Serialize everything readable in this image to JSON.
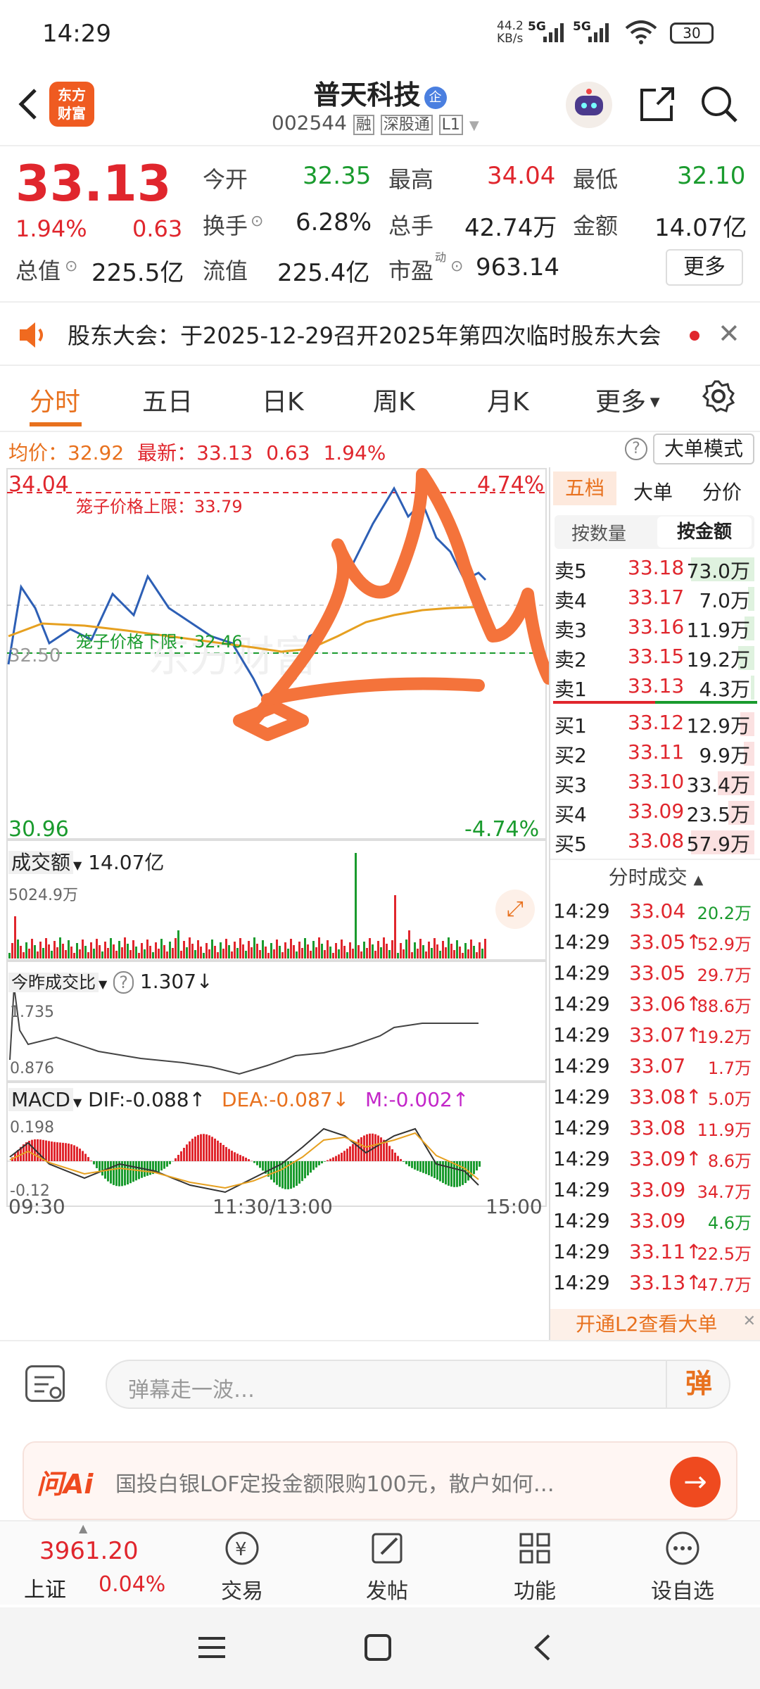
{
  "status_bar": {
    "time": "14:29",
    "net_speed": "44.2",
    "net_unit": "KB/s",
    "signal1": "5G",
    "signal2": "5G",
    "battery": "30"
  },
  "header": {
    "logo_line1": "东方",
    "logo_line2": "财富",
    "stock_name": "普天科技",
    "company_badge": "企",
    "stock_code": "002544",
    "tags": [
      "融",
      "深股通",
      "L1"
    ]
  },
  "quote": {
    "price": "33.13",
    "pct": "1.94%",
    "change": "0.63",
    "open_label": "今开",
    "open": "32.35",
    "high_label": "最高",
    "high": "34.04",
    "low_label": "最低",
    "low": "32.10",
    "turnover_label": "换手",
    "turnover": "6.28%",
    "volume_label": "总手",
    "volume": "42.74万",
    "amount_label": "金额",
    "amount": "14.07亿",
    "mktcap_label": "总值",
    "mktcap": "225.5亿",
    "float_label": "流值",
    "float": "225.4亿",
    "pe_label": "市盈",
    "pe_sup": "动",
    "pe": "963.14",
    "more": "更多"
  },
  "notice": {
    "text": "股东大会：于2025-12-29召开2025年第四次临时股东大会"
  },
  "tabs": [
    "分时",
    "五日",
    "日K",
    "周K",
    "月K",
    "更多"
  ],
  "chart_info": {
    "avg_label": "均价：",
    "avg": "32.92",
    "last_label": "最新：",
    "last": "33.13",
    "chg": "0.63",
    "pct": "1.94%",
    "mode_button": "大单模式"
  },
  "chart_labels": {
    "ymax": "34.04",
    "ymax_pct": "4.74%",
    "ymin": "30.96",
    "ymin_pct": "-4.74%",
    "mid": "32.50",
    "upper_limit": "笼子价格上限：33.79",
    "lower_limit": "笼子价格下限：32.46",
    "watermark": "东方财富"
  },
  "volume_panel": {
    "label": "成交额",
    "value": "14.07亿",
    "max": "5024.9万"
  },
  "ratio_panel": {
    "label": "今昨成交比",
    "value": "1.307",
    "arrow": "↓",
    "max": "1.735",
    "min": "0.876"
  },
  "macd_panel": {
    "label": "MACD",
    "dif": "DIF:-0.088",
    "dif_arrow": "↑",
    "dea": "DEA:-0.087",
    "dea_arrow": "↓",
    "m": "M:-0.002",
    "m_arrow": "↑",
    "max": "0.198",
    "min": "-0.12"
  },
  "time_axis": [
    "09:30",
    "11:30/13:00",
    "15:00"
  ],
  "orderbook": {
    "tabs": [
      "五档",
      "大单",
      "分价"
    ],
    "subtabs": [
      "按数量",
      "按金额"
    ],
    "asks": [
      {
        "label": "卖5",
        "price": "33.18",
        "amount": "73.0万",
        "bar": 1.0
      },
      {
        "label": "卖4",
        "price": "33.17",
        "amount": "7.0万",
        "bar": 0.1
      },
      {
        "label": "卖3",
        "price": "33.16",
        "amount": "11.9万",
        "bar": 0.16
      },
      {
        "label": "卖2",
        "price": "33.15",
        "amount": "19.2万",
        "bar": 0.26
      },
      {
        "label": "卖1",
        "price": "33.13",
        "amount": "4.3万",
        "bar": 0.06
      }
    ],
    "bids": [
      {
        "label": "买1",
        "price": "33.12",
        "amount": "12.9万",
        "bar": 0.22
      },
      {
        "label": "买2",
        "price": "33.11",
        "amount": "9.9万",
        "bar": 0.17
      },
      {
        "label": "买3",
        "price": "33.10",
        "amount": "33.4万",
        "bar": 0.58
      },
      {
        "label": "买4",
        "price": "33.09",
        "amount": "23.5万",
        "bar": 0.41
      },
      {
        "label": "买5",
        "price": "33.08",
        "amount": "57.9万",
        "bar": 1.0
      }
    ],
    "trades_title": "分时成交",
    "trades": [
      {
        "time": "14:29",
        "price": "33.04",
        "vol": "20.2万",
        "c": "green",
        "up": ""
      },
      {
        "time": "14:29",
        "price": "33.05",
        "vol": "52.9万",
        "c": "red",
        "up": "↑"
      },
      {
        "time": "14:29",
        "price": "33.05",
        "vol": "29.7万",
        "c": "red",
        "up": ""
      },
      {
        "time": "14:29",
        "price": "33.06",
        "vol": "88.6万",
        "c": "red",
        "up": "↑"
      },
      {
        "time": "14:29",
        "price": "33.07",
        "vol": "19.2万",
        "c": "red",
        "up": "↑"
      },
      {
        "time": "14:29",
        "price": "33.07",
        "vol": "1.7万",
        "c": "red",
        "up": ""
      },
      {
        "time": "14:29",
        "price": "33.08",
        "vol": "5.0万",
        "c": "red",
        "up": "↑"
      },
      {
        "time": "14:29",
        "price": "33.08",
        "vol": "11.9万",
        "c": "red",
        "up": ""
      },
      {
        "time": "14:29",
        "price": "33.09",
        "vol": "8.6万",
        "c": "red",
        "up": "↑"
      },
      {
        "time": "14:29",
        "price": "33.09",
        "vol": "34.7万",
        "c": "red",
        "up": ""
      },
      {
        "time": "14:29",
        "price": "33.09",
        "vol": "4.6万",
        "c": "green",
        "up": ""
      },
      {
        "time": "14:29",
        "price": "33.11",
        "vol": "22.5万",
        "c": "red",
        "up": "↑"
      },
      {
        "time": "14:29",
        "price": "33.13",
        "vol": "47.7万",
        "c": "red",
        "up": "↑"
      }
    ],
    "l2_banner": "开通L2查看大单"
  },
  "comment": {
    "placeholder": "弹幕走一波…",
    "danmu": "弹"
  },
  "ai_bar": {
    "logo": "问Ai",
    "text": "国投白银LOF定投金额限购100元，散户如何…"
  },
  "bottom_nav": {
    "index_value": "3961.20",
    "index_name": "上证",
    "index_pct": "0.04%",
    "items": [
      "交易",
      "发帖",
      "功能",
      "设自选"
    ]
  }
}
